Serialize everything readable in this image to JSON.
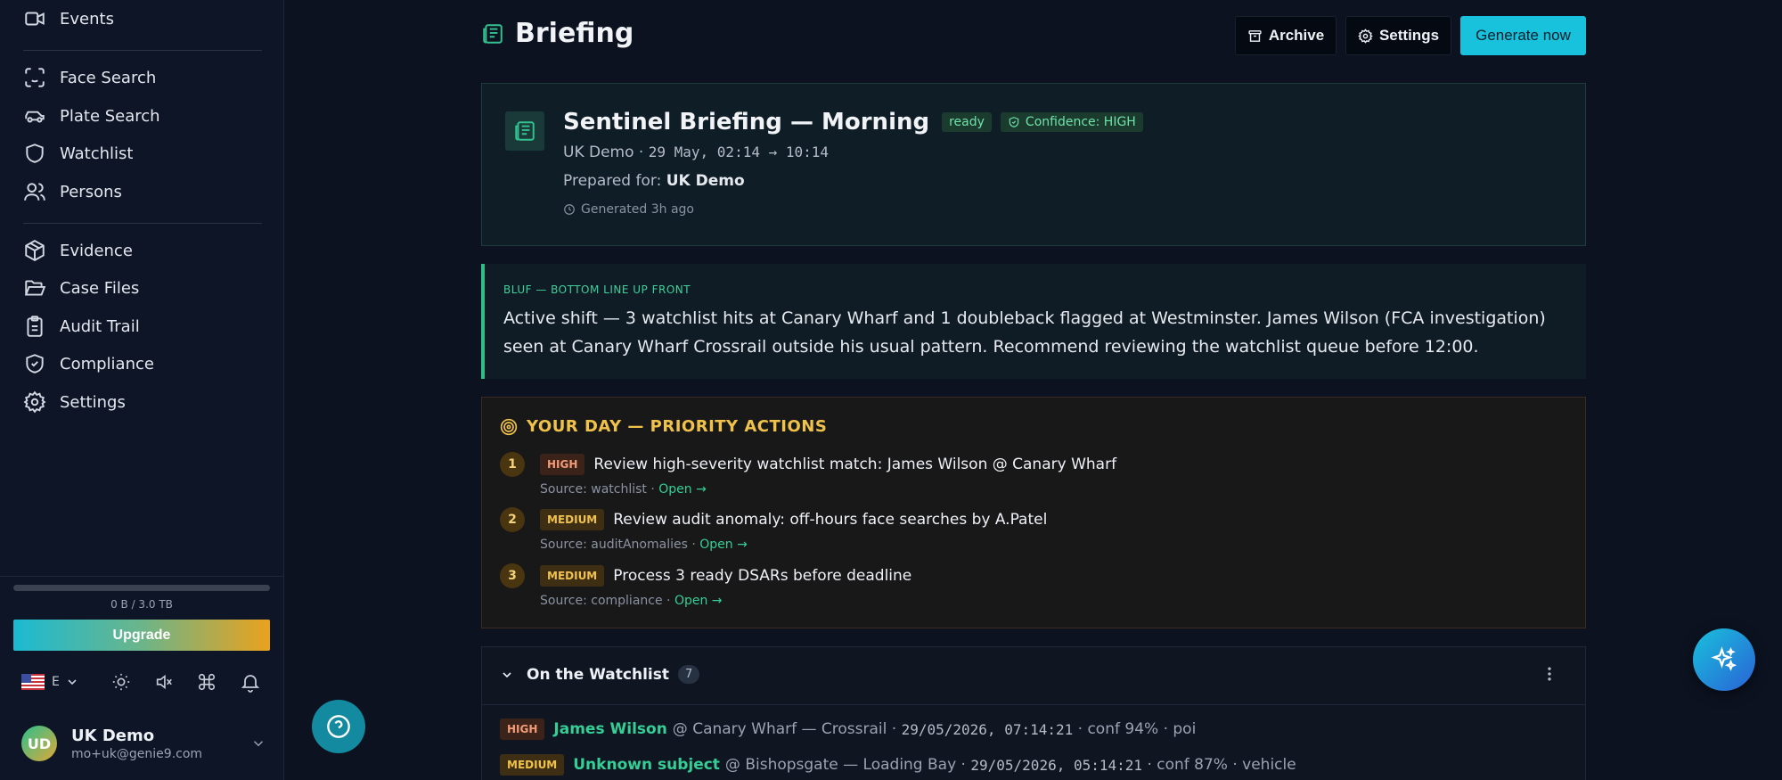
{
  "sidebar": {
    "nav_groups": [
      [
        {
          "label": "Events",
          "icon": "video-camera-icon"
        }
      ],
      [
        {
          "label": "Face Search",
          "icon": "face-scan-icon"
        },
        {
          "label": "Plate Search",
          "icon": "car-icon"
        },
        {
          "label": "Watchlist",
          "icon": "shield-icon"
        },
        {
          "label": "Persons",
          "icon": "users-icon"
        }
      ],
      [
        {
          "label": "Evidence",
          "icon": "box-icon"
        },
        {
          "label": "Case Files",
          "icon": "folder-icon"
        },
        {
          "label": "Audit Trail",
          "icon": "clipboard-icon"
        },
        {
          "label": "Compliance",
          "icon": "shield-check-icon"
        },
        {
          "label": "Settings",
          "icon": "gear-icon"
        }
      ]
    ],
    "storage": {
      "text": "0 B / 3.0 TB",
      "fraction": 0.0
    },
    "upgrade_label": "Upgrade",
    "language_code": "E",
    "user": {
      "initials": "UD",
      "name": "UK Demo",
      "email": "mo+uk@genie9.com"
    }
  },
  "header": {
    "title": "Briefing",
    "archive_label": "Archive",
    "settings_label": "Settings",
    "generate_label": "Generate now"
  },
  "briefing": {
    "title": "Sentinel Briefing — Morning",
    "status": "ready",
    "confidence": "Confidence: HIGH",
    "org": "UK Demo",
    "window": "29 May, 02:14 → 10:14",
    "prepared_label": "Prepared for:",
    "prepared_for": "UK Demo",
    "generated": "Generated 3h ago"
  },
  "bluf": {
    "label": "BLUF — BOTTOM LINE UP FRONT",
    "text": "Active shift — 3 watchlist hits at Canary Wharf and 1 doubleback flagged at Westminster. James Wilson (FCA investigation) seen at Canary Wharf Crossrail outside his usual pattern. Recommend reviewing the watchlist queue before 12:00."
  },
  "your_day": {
    "title": "YOUR DAY — PRIORITY ACTIONS",
    "actions": [
      {
        "num": "1",
        "priority": "HIGH",
        "text": "Review high-severity watchlist match: James Wilson @ Canary Wharf",
        "source": "Source: watchlist ·",
        "link": "Open →"
      },
      {
        "num": "2",
        "priority": "MEDIUM",
        "text": "Review audit anomaly: off-hours face searches by A.Patel",
        "source": "Source: auditAnomalies ·",
        "link": "Open →"
      },
      {
        "num": "3",
        "priority": "MEDIUM",
        "text": "Process 3 ready DSARs before deadline",
        "source": "Source: compliance ·",
        "link": "Open →"
      }
    ]
  },
  "watchlist": {
    "title": "On the Watchlist",
    "count": "7",
    "hits": [
      {
        "priority": "HIGH",
        "name": "James Wilson",
        "location": "@ Canary Wharf — Crossrail ·",
        "time": "29/05/2026, 07:14:21",
        "detail": "· conf 94% · poi"
      },
      {
        "priority": "MEDIUM",
        "name": "Unknown subject",
        "location": "@ Bishopsgate — Loading Bay ·",
        "time": "29/05/2026, 05:14:21",
        "detail": "· conf 87% · vehicle"
      }
    ]
  },
  "colors": {
    "accent": "#18c1dc",
    "success": "#35cf95",
    "warning": "#f0c24a",
    "danger": "#f39a76"
  }
}
